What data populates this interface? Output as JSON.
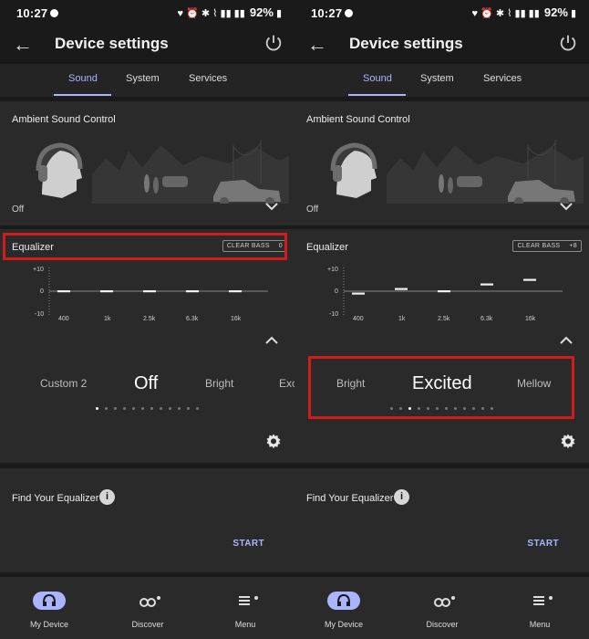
{
  "status_bar": {
    "time": "10:27",
    "battery": "92%"
  },
  "header": {
    "title": "Device settings"
  },
  "tabs": [
    {
      "label": "Sound"
    },
    {
      "label": "System"
    },
    {
      "label": "Services"
    }
  ],
  "ambient": {
    "label": "Ambient Sound Control",
    "value": "Off"
  },
  "equalizer": {
    "label": "Equalizer",
    "clear_bass_label": "CLEAR BASS",
    "y_ticks": [
      "+10",
      "0",
      "-10"
    ],
    "x_ticks": [
      "400",
      "1k",
      "2.5k",
      "6.3k",
      "16k"
    ]
  },
  "left_screen": {
    "clear_bass_value": "0",
    "band_levels": [
      0,
      0,
      0,
      0,
      0
    ],
    "presets": {
      "prev": "Custom 2",
      "current": "Off",
      "next": "Bright",
      "next2": "Exc"
    },
    "active_dot": 0
  },
  "right_screen": {
    "clear_bass_value": "+8",
    "band_levels": [
      -1,
      1,
      0,
      3,
      5
    ],
    "presets": {
      "prev": "Bright",
      "current": "Excited",
      "next": "Mellow"
    },
    "active_dot": 2
  },
  "find_equalizer": {
    "label": "Find Your Equalizer",
    "info_symbol": "i",
    "start_label": "START"
  },
  "bottom_nav": [
    {
      "label": "My Device"
    },
    {
      "label": "Discover"
    },
    {
      "label": "Menu"
    }
  ],
  "colors": {
    "accent": "#a9b6ff",
    "highlight": "#d11c1c",
    "background": "#1a1a1a",
    "card": "#2a2a2a"
  }
}
